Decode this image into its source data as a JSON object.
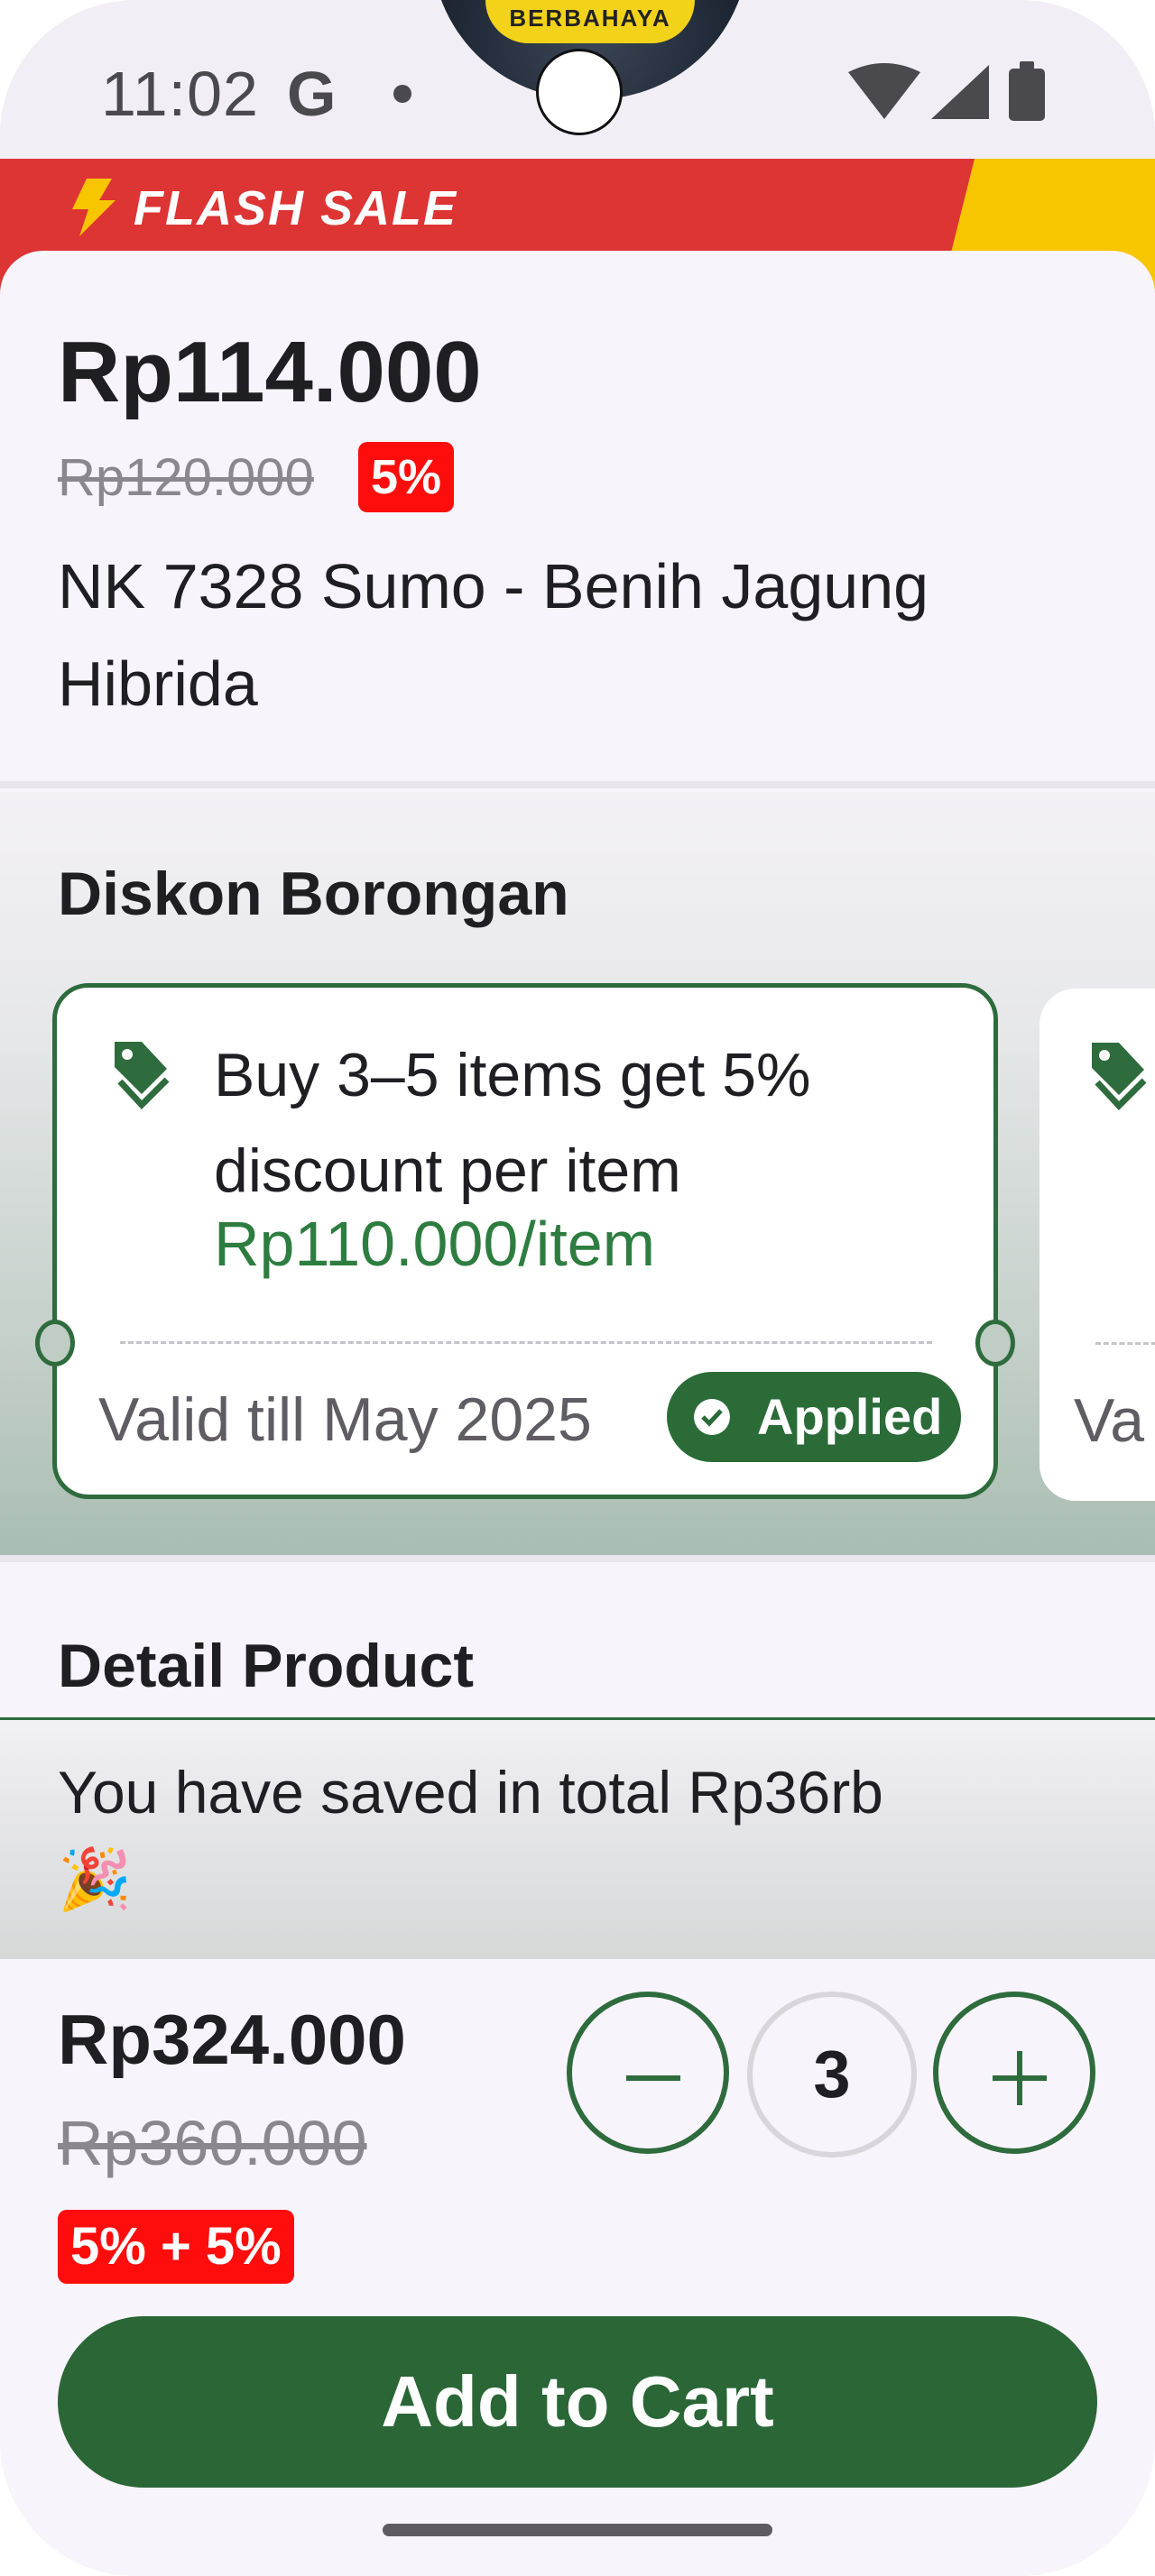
{
  "status_bar": {
    "time": "11:02",
    "g_glyph": "G",
    "product_label": "BERBAHAYA"
  },
  "flash_sale": {
    "label": "FLASH SALE"
  },
  "product": {
    "price": "Rp114.000",
    "old_price": "Rp120.000",
    "discount_badge": "5%",
    "name": "NK 7328 Sumo - Benih Jagung Hibrida"
  },
  "diskon": {
    "title": "Diskon Borongan",
    "cards": [
      {
        "offer": "Buy 3–5 items get 5% discount per item",
        "price_per_item": "Rp110.000/item",
        "valid": "Valid till May 2025",
        "status": "Applied"
      },
      {
        "valid": "Va"
      }
    ]
  },
  "detail": {
    "title": "Detail Product",
    "saved_text": "You have saved in total Rp36rb",
    "saved_emoji": "🎉"
  },
  "bottom": {
    "total": "Rp324.000",
    "total_old": "Rp360.000",
    "discount_badge": "5% + 5%",
    "quantity": "3",
    "add_to_cart": "Add to Cart"
  },
  "colors": {
    "brand_green": "#2a6636",
    "flash_red": "#dd3434",
    "flash_yellow": "#f7c600",
    "badge_red": "#ff0d0d"
  }
}
